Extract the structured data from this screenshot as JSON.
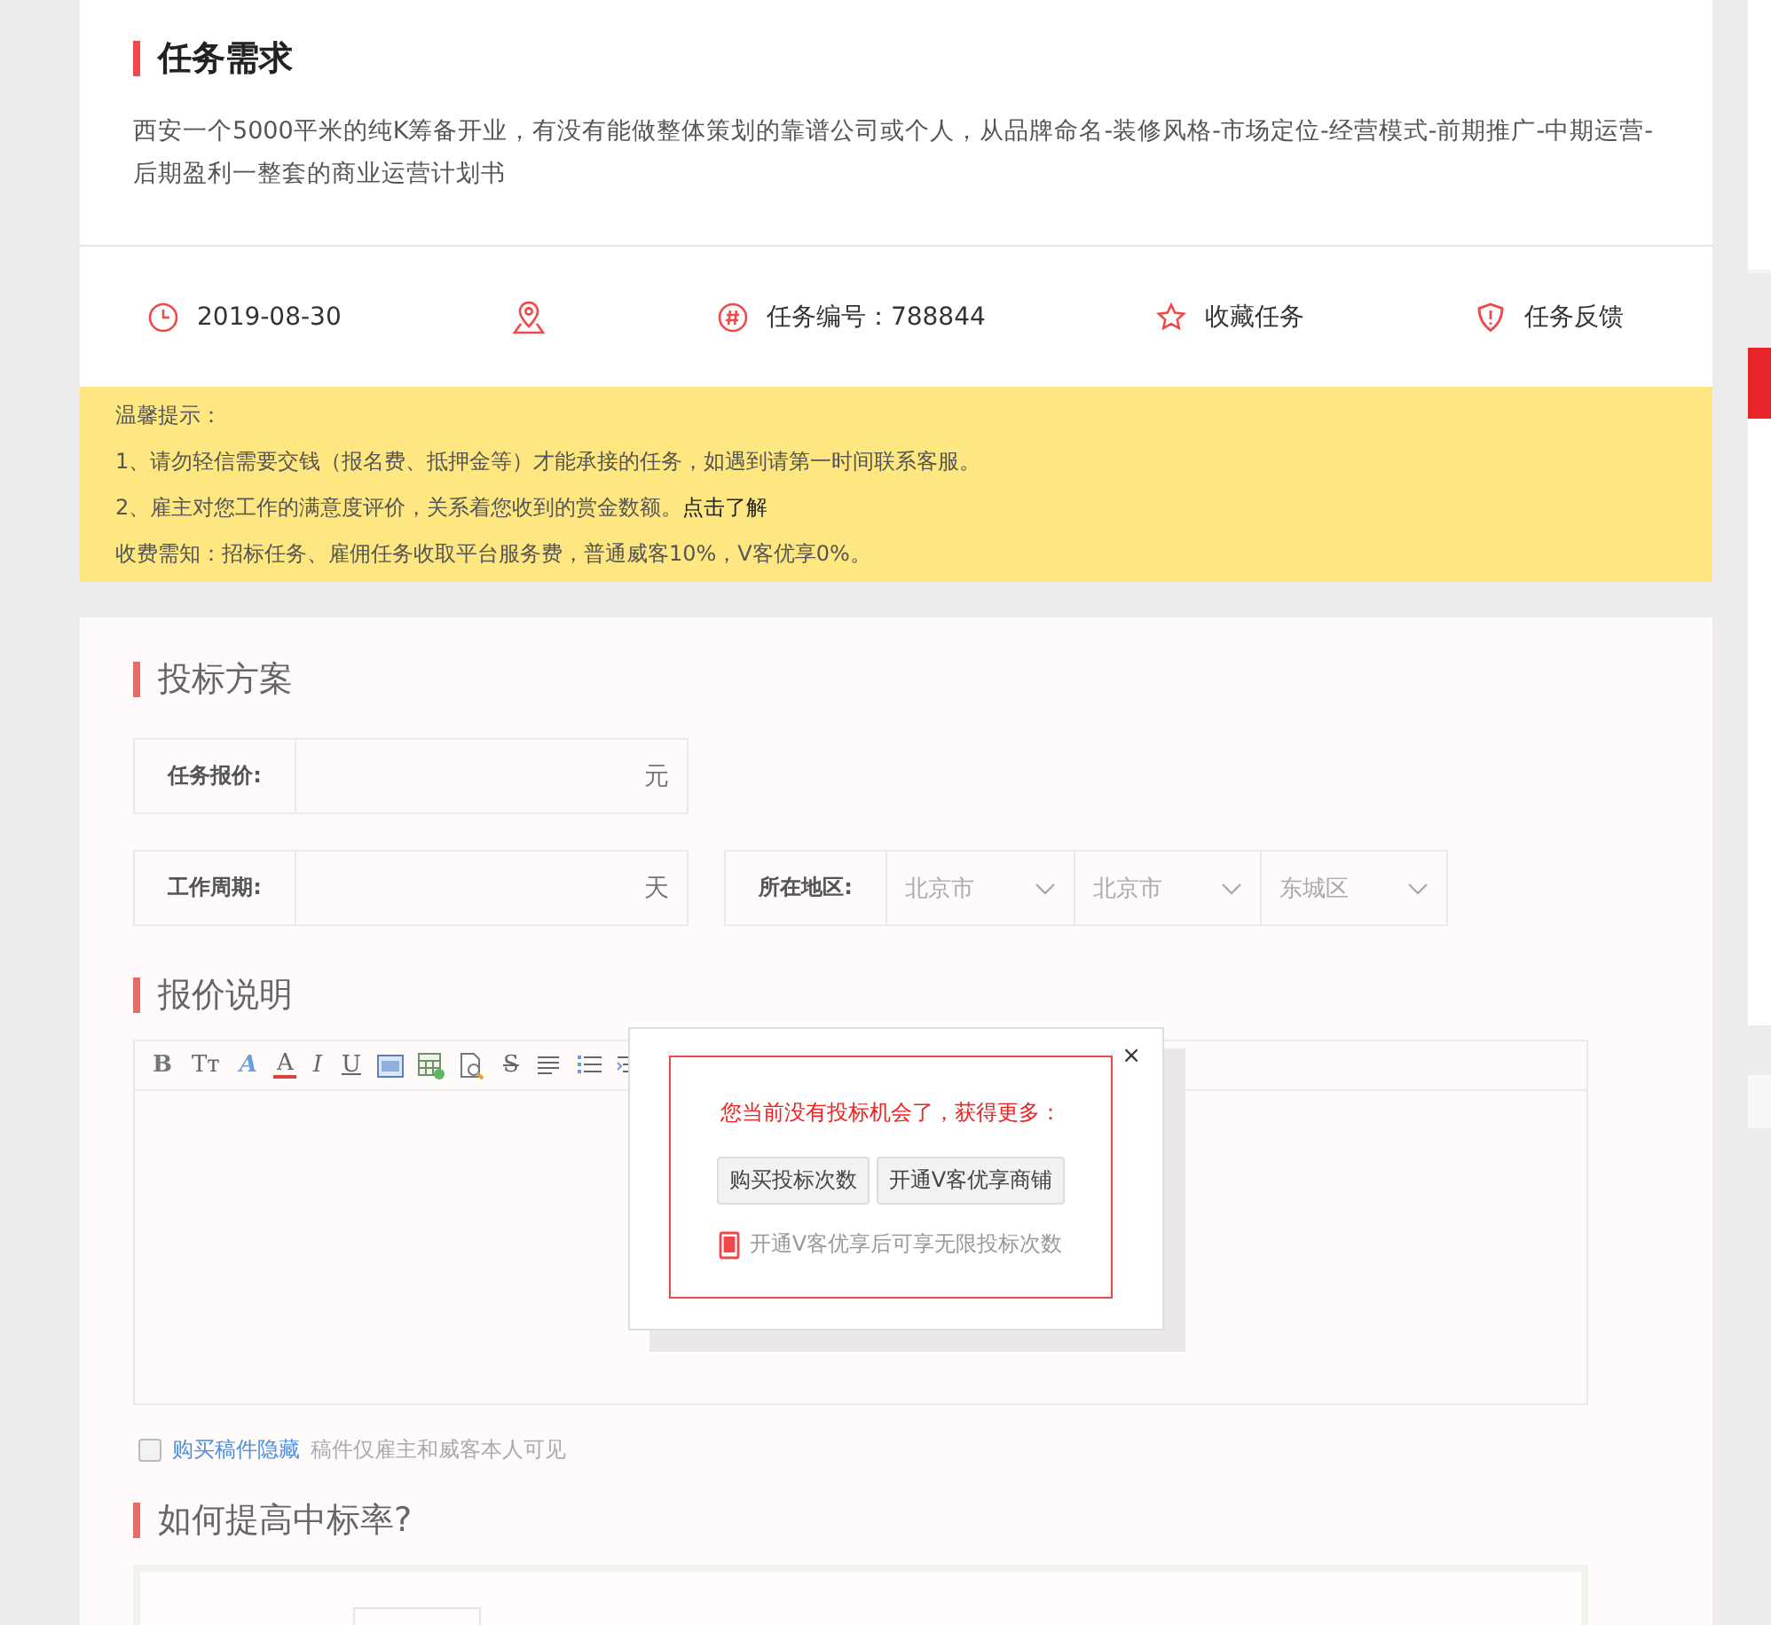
{
  "task": {
    "title": "任务需求",
    "description": "西安一个5000平米的纯K筹备开业，有没有能做整体策划的靠谱公司或个人，从品牌命名-装修风格-市场定位-经营模式-前期推广-中期运营-后期盈利一整套的商业运营计划书"
  },
  "info_bar": [
    {
      "kind": "clock",
      "text": "2019-08-30"
    },
    {
      "kind": "location"
    },
    {
      "kind": "hash",
      "text": "任务编号：788844"
    },
    {
      "kind": "star",
      "text": "收藏任务"
    },
    {
      "kind": "shield",
      "text": "任务反馈"
    }
  ],
  "notice": {
    "title": "温馨提示：",
    "lines": [
      {
        "text": "1、请勿轻信需要交钱（报名费、抵押金等）才能承接的任务，如遇到请第一时间联系客服。"
      },
      {
        "text": "2、雇主对您工作的满意度评价，关系着您收到的赏金数额。",
        "link": "点击了解"
      }
    ],
    "fee": "收费需知：招标任务、雇佣任务收取平台服务费，普通威客10%，V客优享0%。"
  },
  "bid": {
    "title": "投标方案",
    "price_label": "任务报价:",
    "price_unit": "元",
    "period_label": "工作周期:",
    "period_unit": "天",
    "region_label": "所在地区:",
    "region_selects": [
      "北京市",
      "北京市",
      "东城区"
    ]
  },
  "quote": {
    "title": "报价说明",
    "toolbar": [
      {
        "kind": "glyph",
        "label": "B"
      },
      {
        "kind": "glyph",
        "label": "Tт"
      },
      {
        "kind": "glyph",
        "label": "A"
      },
      {
        "kind": "glyph",
        "label": "A"
      },
      {
        "kind": "glyph",
        "label": "I"
      },
      {
        "kind": "glyph",
        "label": "U"
      },
      {
        "kind": "image"
      },
      {
        "kind": "table"
      },
      {
        "kind": "preview"
      },
      {
        "kind": "glyph",
        "label": "S"
      },
      {
        "kind": "align"
      },
      {
        "kind": "list"
      },
      {
        "kind": "indent"
      }
    ]
  },
  "hide_option": {
    "checked": false,
    "link": "购买稿件隐藏",
    "note": "稿件仅雇主和威客本人可见"
  },
  "tips": {
    "title": "如何提高中标率?"
  },
  "popup": {
    "message": "您当前没有投标机会了，获得更多：",
    "buttons": [
      "购买投标次数",
      "开通V客优享商铺"
    ],
    "note": "开通V客优享后可享无限投标次数",
    "close": "×"
  }
}
